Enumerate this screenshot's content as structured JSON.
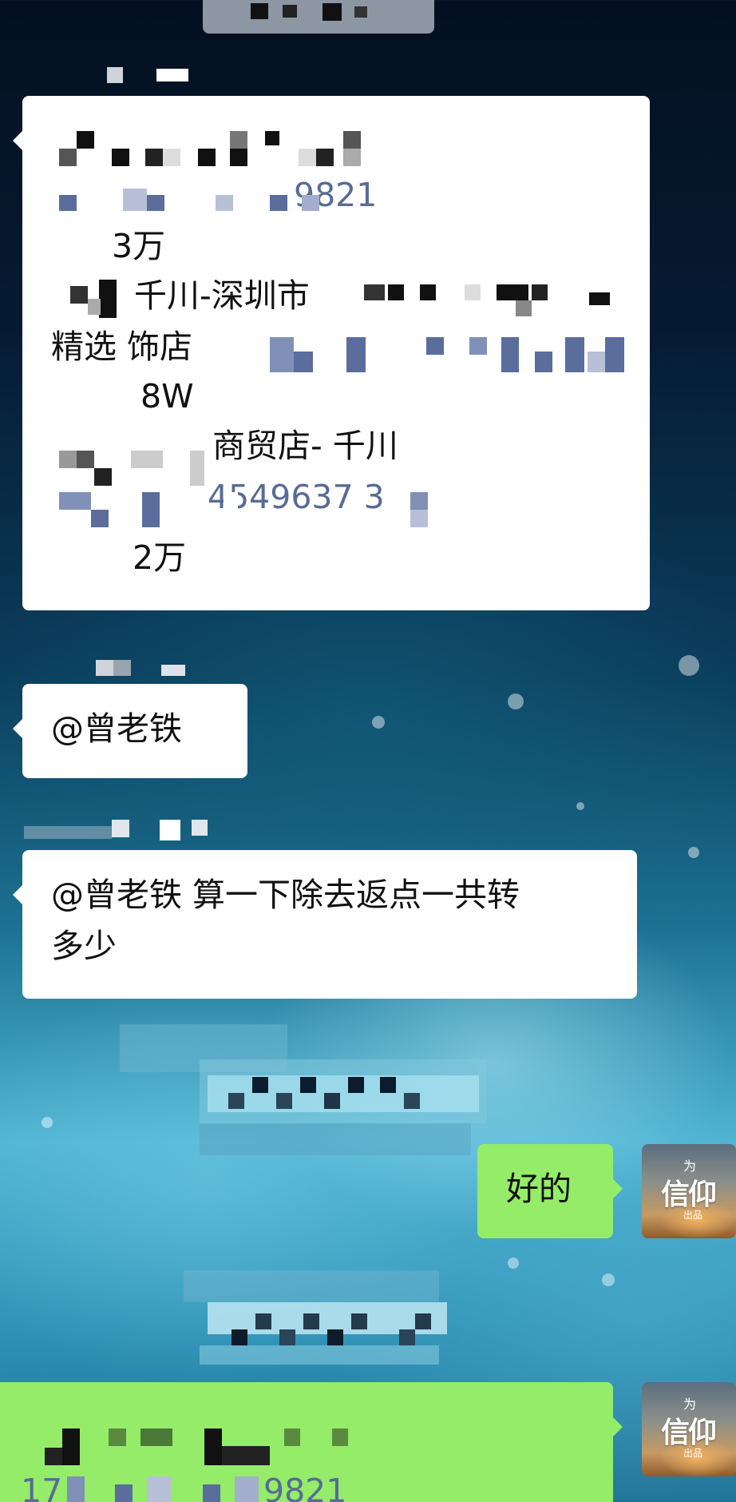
{
  "messages": {
    "listing": {
      "line1_amount": "3万",
      "line2_text": "千川-深圳市",
      "line3_text": "精选 饰店",
      "line4_amount": "8W",
      "line5_text": "商贸店- 千川",
      "line6_number": "4549637 3",
      "line7_amount": "2万",
      "id_fragment": "9821"
    },
    "mention": {
      "text": "@曾老铁"
    },
    "question": {
      "line1": "@曾老铁 算一下除去返点一共转",
      "line2": "多少"
    },
    "reply": {
      "text": "好的"
    },
    "last": {
      "id_fragment": "9821",
      "prefix": "17"
    }
  },
  "avatar": {
    "small_text": "为",
    "big_text": "信仰",
    "tiny_text": "出品"
  },
  "colors": {
    "incoming_bubble": "#ffffff",
    "outgoing_bubble": "#95ec69",
    "link_blue": "#576b95"
  }
}
